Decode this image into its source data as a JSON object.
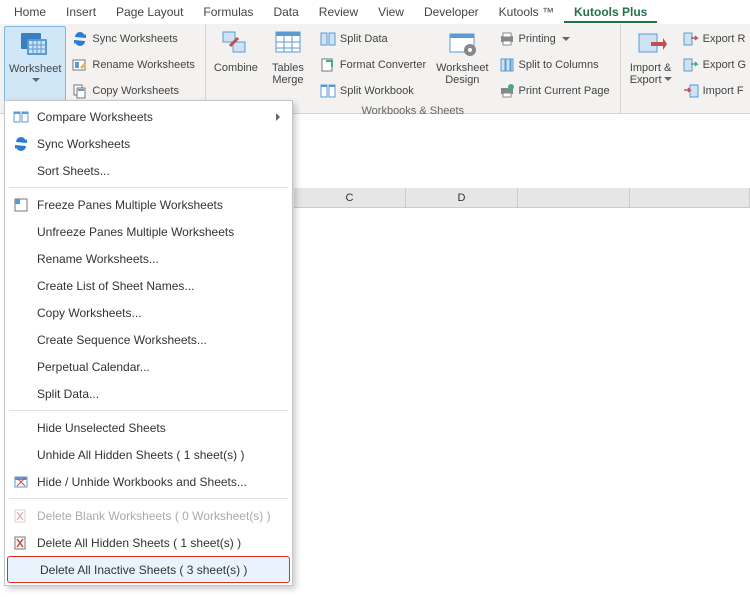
{
  "tabs": {
    "home": "Home",
    "insert": "Insert",
    "page_layout": "Page Layout",
    "formulas": "Formulas",
    "data": "Data",
    "review": "Review",
    "view": "View",
    "developer": "Developer",
    "kutools": "Kutools ™",
    "kutools_plus": "Kutools Plus"
  },
  "ribbon": {
    "g1": {
      "worksheet": "Worksheet",
      "sync": "Sync Worksheets",
      "rename": "Rename Worksheets",
      "copy": "Copy Worksheets"
    },
    "g2": {
      "combine": "Combine",
      "tables_merge": "Tables\nMerge",
      "split_data": "Split Data",
      "format_conv": "Format Converter",
      "split_wb": "Split Workbook",
      "wb_design": "Worksheet\nDesign",
      "printing": "Printing",
      "split_cols": "Split to Columns",
      "print_current": "Print Current Page",
      "group_label": "Workbooks & Sheets"
    },
    "g3": {
      "import_export": "Import &\nExport",
      "export_r": "Export R",
      "export_c": "Export G",
      "import_f": "Import F"
    }
  },
  "menu": {
    "compare": "Compare Worksheets",
    "sync": "Sync Worksheets",
    "sort": "Sort Sheets...",
    "freeze": "Freeze Panes Multiple Worksheets",
    "unfreeze": "Unfreeze Panes Multiple Worksheets",
    "rename": "Rename Worksheets...",
    "create_list": "Create List of Sheet Names...",
    "copy": "Copy Worksheets...",
    "create_seq": "Create Sequence Worksheets...",
    "perpetual": "Perpetual Calendar...",
    "split": "Split Data...",
    "hide_unsel": "Hide Unselected Sheets",
    "unhide_all": "Unhide All Hidden Sheets ( 1 sheet(s) )",
    "hide_unhide": "Hide / Unhide Workbooks and Sheets...",
    "del_blank": "Delete Blank Worksheets ( 0 Worksheet(s) )",
    "del_hidden": "Delete All Hidden Sheets ( 1 sheet(s) )",
    "del_inactive": "Delete All Inactive Sheets ( 3 sheet(s) )"
  },
  "cols": {
    "c": "C",
    "d": "D"
  }
}
